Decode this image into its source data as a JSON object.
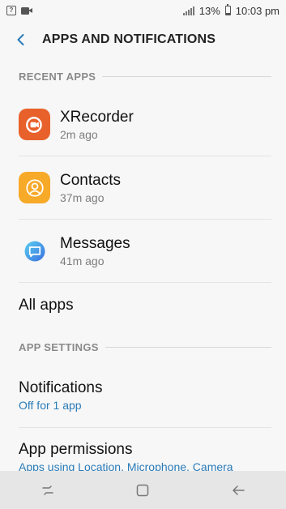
{
  "status_bar": {
    "battery": "13%",
    "time": "10:03 pm"
  },
  "header": {
    "title": "APPS AND NOTIFICATIONS"
  },
  "recent_apps": {
    "section_label": "RECENT APPS",
    "items": [
      {
        "name": "XRecorder",
        "time": "2m ago",
        "icon": "xrecorder-icon",
        "color": "#e8612a"
      },
      {
        "name": "Contacts",
        "time": "37m ago",
        "icon": "contacts-icon",
        "color": "#f7a928"
      },
      {
        "name": "Messages",
        "time": "41m ago",
        "icon": "messages-icon",
        "color": "#3a9fe3"
      }
    ]
  },
  "all_apps": {
    "label": "All apps"
  },
  "app_settings": {
    "section_label": "APP SETTINGS",
    "notifications": {
      "label": "Notifications",
      "sub": "Off for 1 app"
    },
    "permissions": {
      "label": "App permissions",
      "sub": "Apps using Location, Microphone, Camera"
    }
  },
  "colors": {
    "accent_blue": "#2a7bb8",
    "nav_bar": "#e6e6e6"
  }
}
